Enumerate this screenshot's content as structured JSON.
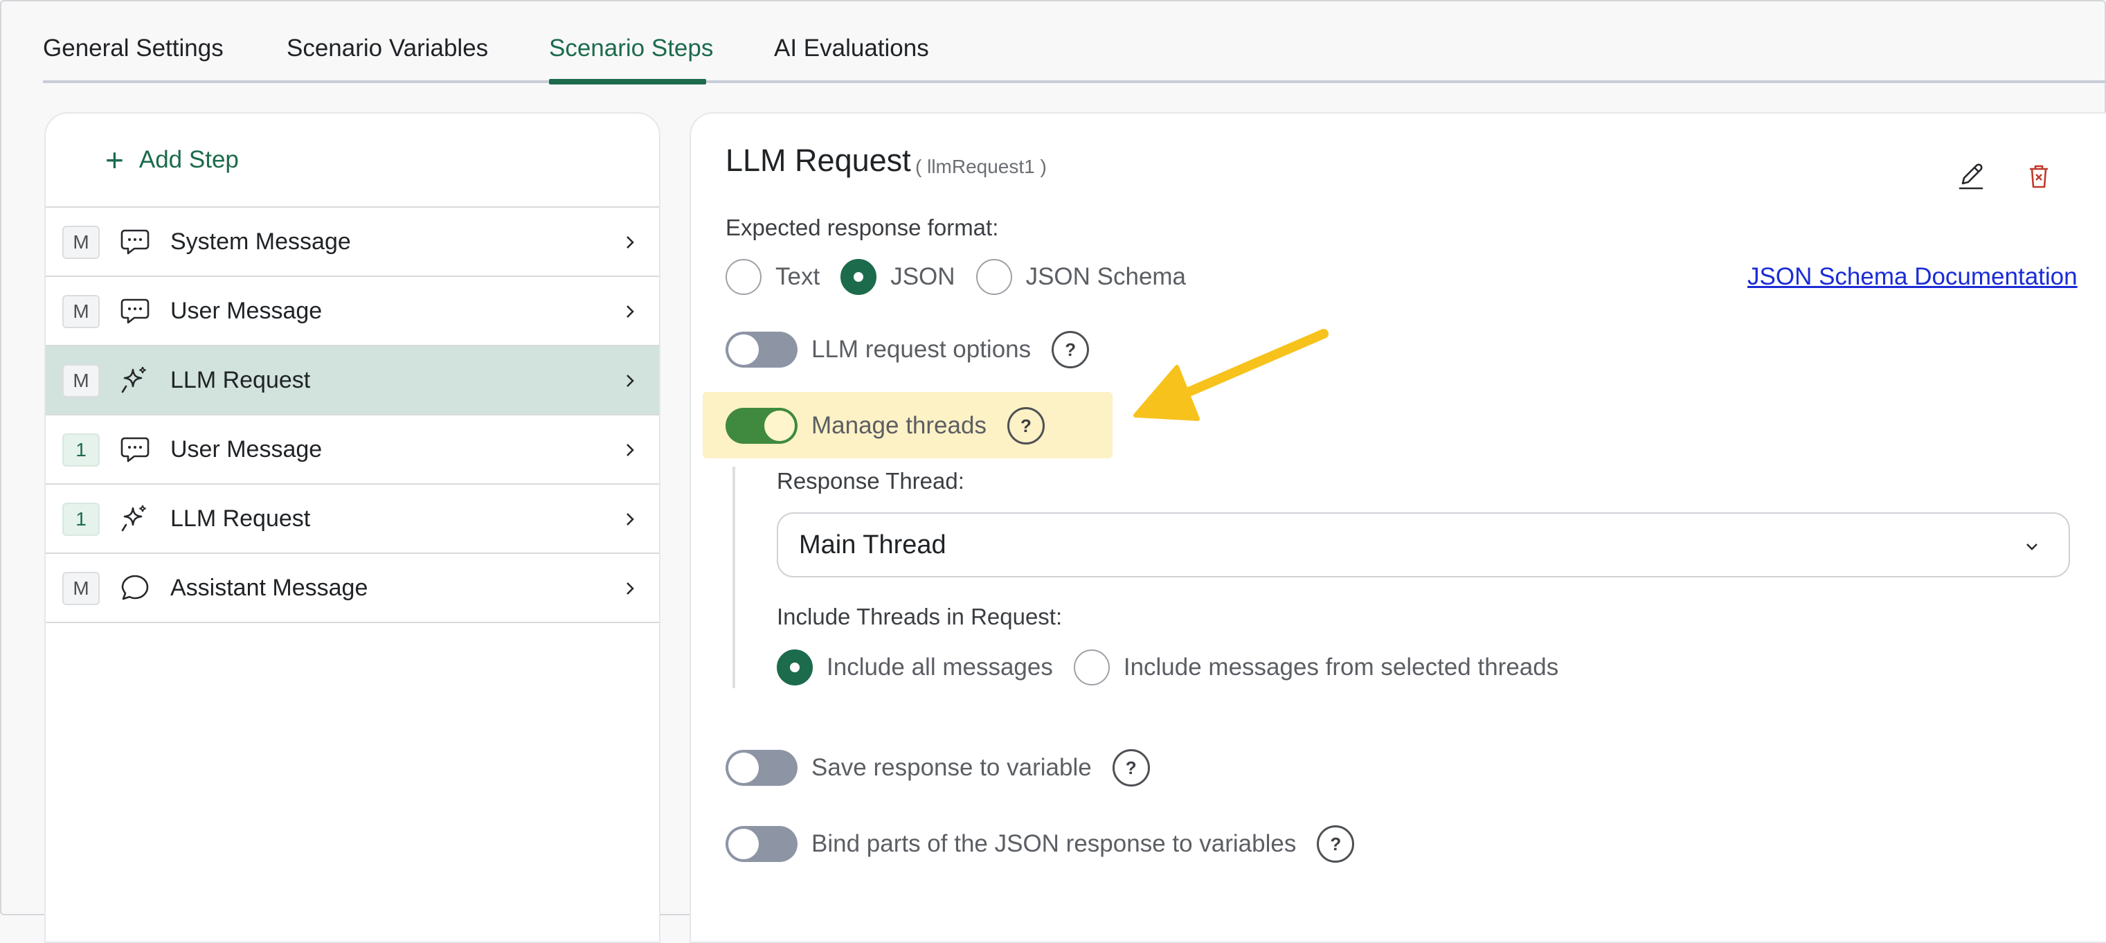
{
  "tabs": [
    {
      "label": "General Settings"
    },
    {
      "label": "Scenario Variables"
    },
    {
      "label": "Scenario Steps",
      "active": true
    },
    {
      "label": "AI Evaluations"
    }
  ],
  "left": {
    "add_step": "Add Step",
    "steps": [
      {
        "badge": "M",
        "icon": "message-dots-icon",
        "label": "System Message"
      },
      {
        "badge": "M",
        "icon": "message-dots-icon",
        "label": "User Message"
      },
      {
        "badge": "M",
        "icon": "sparkles-icon",
        "label": "LLM Request",
        "active": true
      },
      {
        "badge": "1",
        "icon": "message-dots-icon",
        "label": "User Message"
      },
      {
        "badge": "1",
        "icon": "sparkles-icon",
        "label": "LLM Request"
      },
      {
        "badge": "M",
        "icon": "chat-bubble-icon",
        "label": "Assistant Message"
      }
    ]
  },
  "detail": {
    "title": "LLM Request",
    "subtitle": "( llmRequest1 )",
    "format_label": "Expected response format:",
    "format_options": [
      "Text",
      "JSON",
      "JSON Schema"
    ],
    "format_selected": "JSON",
    "schema_link": "JSON Schema Documentation",
    "llm_options": {
      "label": "LLM request options",
      "on": false
    },
    "manage_threads": {
      "label": "Manage threads",
      "on": true
    },
    "response_thread_label": "Response Thread:",
    "response_thread_value": "Main Thread",
    "include_label": "Include Threads in Request:",
    "include_options": [
      "Include all messages",
      "Include messages from selected threads"
    ],
    "include_selected": "Include all messages",
    "save_response": {
      "label": "Save response to variable",
      "on": false
    },
    "bind_json": {
      "label": "Bind parts of the JSON response to variables",
      "on": false
    },
    "help_glyph": "?"
  },
  "colors": {
    "accent": "#1c6b4c",
    "toggle_on": "#3f8a3e",
    "highlight": "#fdf1c6",
    "arrow": "#f7c21b",
    "delete": "#c0392b"
  }
}
